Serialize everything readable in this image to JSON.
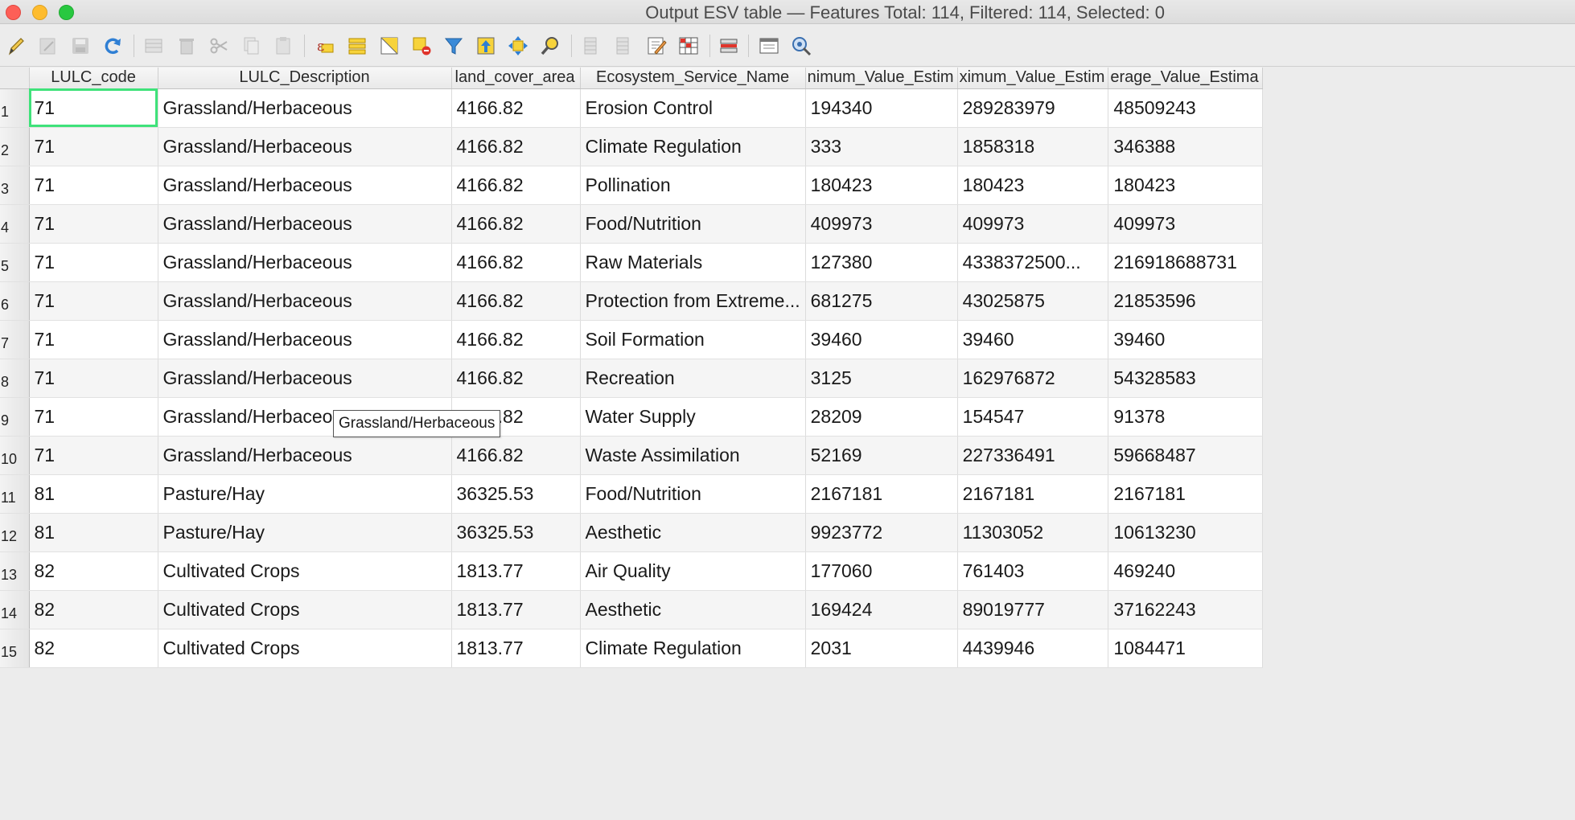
{
  "window": {
    "title": "Output ESV table — Features Total: 114, Filtered: 114, Selected: 0"
  },
  "toolbar": {
    "buttons": [
      {
        "icon": "pencil-icon",
        "label": "Toggle editing mode",
        "enabled": true
      },
      {
        "icon": "multi-edit-icon",
        "label": "Toggle multi edit mode",
        "enabled": false
      },
      {
        "icon": "save-icon",
        "label": "Save edits",
        "enabled": false
      },
      {
        "icon": "reload-icon",
        "label": "Reload the table",
        "enabled": true
      },
      {
        "icon": "add-feature-icon",
        "label": "Add feature",
        "enabled": false
      },
      {
        "icon": "delete-icon",
        "label": "Delete selected features",
        "enabled": false
      },
      {
        "icon": "cut-icon",
        "label": "Cut selected rows",
        "enabled": false
      },
      {
        "icon": "copy-icon",
        "label": "Copy selected rows",
        "enabled": false
      },
      {
        "icon": "paste-icon",
        "label": "Paste features",
        "enabled": false
      },
      {
        "icon": "select-expression-icon",
        "label": "Select features using an expression",
        "enabled": true
      },
      {
        "icon": "select-all-icon",
        "label": "Select all",
        "enabled": true
      },
      {
        "icon": "invert-selection-icon",
        "label": "Invert selection",
        "enabled": true
      },
      {
        "icon": "deselect-icon",
        "label": "Deselect all",
        "enabled": true
      },
      {
        "icon": "filter-icon",
        "label": "Filter/Select features using form",
        "enabled": true
      },
      {
        "icon": "move-top-icon",
        "label": "Move selection to top",
        "enabled": true
      },
      {
        "icon": "pan-icon",
        "label": "Pan map to selected rows",
        "enabled": true
      },
      {
        "icon": "zoom-icon",
        "label": "Zoom map to selected rows",
        "enabled": true
      },
      {
        "icon": "new-field-icon",
        "label": "New field",
        "enabled": false
      },
      {
        "icon": "delete-field-icon",
        "label": "Delete field",
        "enabled": false
      },
      {
        "icon": "field-calculator-icon",
        "label": "Open field calculator",
        "enabled": true
      },
      {
        "icon": "conditional-format-icon",
        "label": "Conditional formatting",
        "enabled": true
      },
      {
        "icon": "organize-columns-icon",
        "label": "Organize columns",
        "enabled": true
      },
      {
        "icon": "dock-icon",
        "label": "Dock attribute table",
        "enabled": true
      },
      {
        "icon": "actions-icon",
        "label": "Actions",
        "enabled": true
      }
    ]
  },
  "table": {
    "columns": [
      "LULC_code",
      "LULC_Description",
      "land_cover_area",
      "Ecosystem_Service_Name",
      "nimum_Value_Estim",
      "ximum_Value_Estim",
      "erage_Value_Estima"
    ],
    "rows": [
      {
        "n": "1",
        "cells": [
          "71",
          "Grassland/Herbaceous",
          "4166.82",
          "Erosion Control",
          "194340",
          "289283979",
          "48509243"
        ]
      },
      {
        "n": "2",
        "cells": [
          "71",
          "Grassland/Herbaceous",
          "4166.82",
          "Climate Regulation",
          "333",
          "1858318",
          "346388"
        ]
      },
      {
        "n": "3",
        "cells": [
          "71",
          "Grassland/Herbaceous",
          "4166.82",
          "Pollination",
          "180423",
          "180423",
          "180423"
        ]
      },
      {
        "n": "4",
        "cells": [
          "71",
          "Grassland/Herbaceous",
          "4166.82",
          "Food/Nutrition",
          "409973",
          "409973",
          "409973"
        ]
      },
      {
        "n": "5",
        "cells": [
          "71",
          "Grassland/Herbaceous",
          "4166.82",
          "Raw Materials",
          "127380",
          "4338372500...",
          "216918688731"
        ]
      },
      {
        "n": "6",
        "cells": [
          "71",
          "Grassland/Herbaceous",
          "4166.82",
          "Protection from Extreme...",
          "681275",
          "43025875",
          "21853596"
        ]
      },
      {
        "n": "7",
        "cells": [
          "71",
          "Grassland/Herbaceous",
          "4166.82",
          "Soil Formation",
          "39460",
          "39460",
          "39460"
        ]
      },
      {
        "n": "8",
        "cells": [
          "71",
          "Grassland/Herbaceous",
          "4166.82",
          "Recreation",
          "3125",
          "162976872",
          "54328583"
        ]
      },
      {
        "n": "9",
        "cells": [
          "71",
          "Grassland/Herbaceous",
          "4166.82",
          "Water Supply",
          "28209",
          "154547",
          "91378"
        ]
      },
      {
        "n": "10",
        "cells": [
          "71",
          "Grassland/Herbaceous",
          "4166.82",
          "Waste Assimilation",
          "52169",
          "227336491",
          "59668487"
        ]
      },
      {
        "n": "11",
        "cells": [
          "81",
          "Pasture/Hay",
          "36325.53",
          "Food/Nutrition",
          "2167181",
          "2167181",
          "2167181"
        ]
      },
      {
        "n": "12",
        "cells": [
          "81",
          "Pasture/Hay",
          "36325.53",
          "Aesthetic",
          "9923772",
          "11303052",
          "10613230"
        ]
      },
      {
        "n": "13",
        "cells": [
          "82",
          "Cultivated Crops",
          "1813.77",
          "Air Quality",
          "177060",
          "761403",
          "469240"
        ]
      },
      {
        "n": "14",
        "cells": [
          "82",
          "Cultivated Crops",
          "1813.77",
          "Aesthetic",
          "169424",
          "89019777",
          "37162243"
        ]
      },
      {
        "n": "15",
        "cells": [
          "82",
          "Cultivated Crops",
          "1813.77",
          "Climate Regulation",
          "2031",
          "4439946",
          "1084471"
        ]
      }
    ]
  },
  "tooltip": {
    "text": "Grassland/Herbaceous"
  },
  "colors": {
    "current_cell_border": "#3fe27a"
  }
}
